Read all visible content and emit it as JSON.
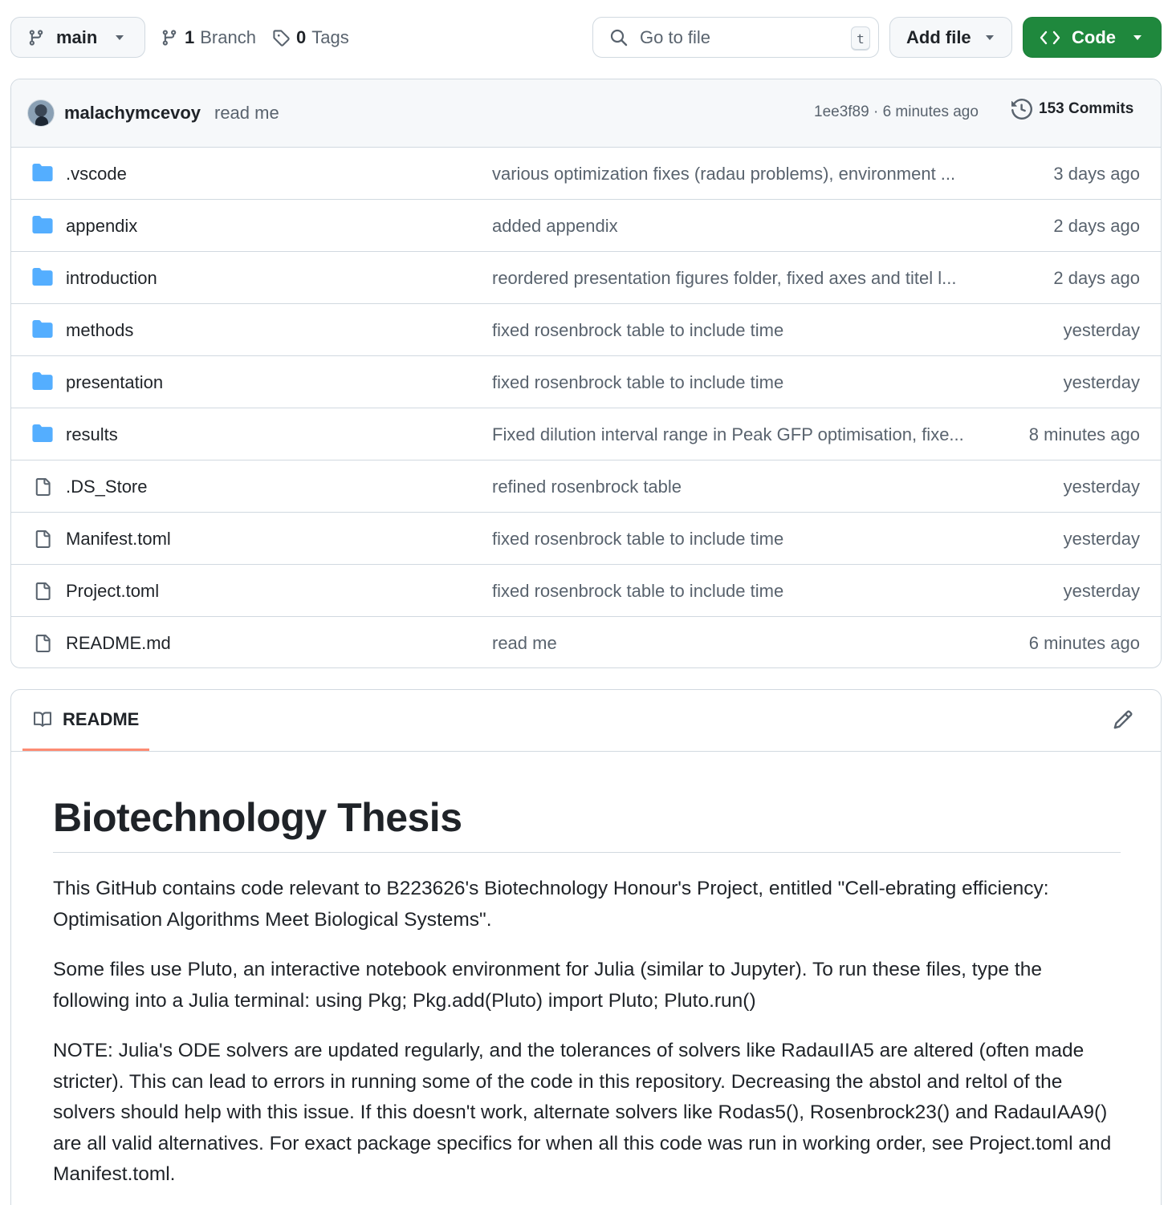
{
  "toolbar": {
    "branch": "main",
    "branch_count": "1",
    "branch_label": "Branch",
    "tag_count": "0",
    "tag_label": "Tags",
    "goto_placeholder": "Go to file",
    "goto_shortcut": "t",
    "add_file": "Add file",
    "code": "Code"
  },
  "latest_commit": {
    "author": "malachymcevoy",
    "message": "read me",
    "meta": "1ee3f89 · 6 minutes ago",
    "commit_count": "153 Commits"
  },
  "files": [
    {
      "type": "folder",
      "name": ".vscode",
      "message": "various optimization fixes (radau problems), environment ...",
      "date": "3 days ago"
    },
    {
      "type": "folder",
      "name": "appendix",
      "message": "added appendix",
      "date": "2 days ago"
    },
    {
      "type": "folder",
      "name": "introduction",
      "message": "reordered presentation figures folder, fixed axes and titel l...",
      "date": "2 days ago"
    },
    {
      "type": "folder",
      "name": "methods",
      "message": "fixed rosenbrock table to include time",
      "date": "yesterday"
    },
    {
      "type": "folder",
      "name": "presentation",
      "message": "fixed rosenbrock table to include time",
      "date": "yesterday"
    },
    {
      "type": "folder",
      "name": "results",
      "message": "Fixed dilution interval range in Peak GFP optimisation, fixe...",
      "date": "8 minutes ago"
    },
    {
      "type": "file",
      "name": ".DS_Store",
      "message": "refined rosenbrock table",
      "date": "yesterday"
    },
    {
      "type": "file",
      "name": "Manifest.toml",
      "message": "fixed rosenbrock table to include time",
      "date": "yesterday"
    },
    {
      "type": "file",
      "name": "Project.toml",
      "message": "fixed rosenbrock table to include time",
      "date": "yesterday"
    },
    {
      "type": "file",
      "name": "README.md",
      "message": "read me",
      "date": "6 minutes ago"
    }
  ],
  "readme": {
    "tab_label": "README",
    "title": "Biotechnology Thesis",
    "paragraphs": [
      "This GitHub contains code relevant to B223626's Biotechnology Honour's Project, entitled \"Cell-ebrating efficiency: Optimisation Algorithms Meet Biological Systems\".",
      "Some files use Pluto, an interactive notebook environment for Julia (similar to Jupyter). To run these files, type the following into a Julia terminal: using Pkg; Pkg.add(Pluto) import Pluto; Pluto.run()",
      "NOTE: Julia's ODE solvers are updated regularly, and the tolerances of solvers like RadauIIA5 are altered (often made stricter). This can lead to errors in running some of the code in this repository. Decreasing the abstol and reltol of the solvers should help with this issue. If this doesn't work, alternate solvers like Rodas5(), Rosenbrock23() and RadauIAA9() are all valid alternatives. For exact package specifics for when all this code was run in working order, see Project.toml and Manifest.toml."
    ]
  },
  "colors": {
    "folder_icon": "#54aeff",
    "code_button": "#1f883d",
    "tab_underline": "#fd8c73",
    "muted_text": "#59636e"
  }
}
